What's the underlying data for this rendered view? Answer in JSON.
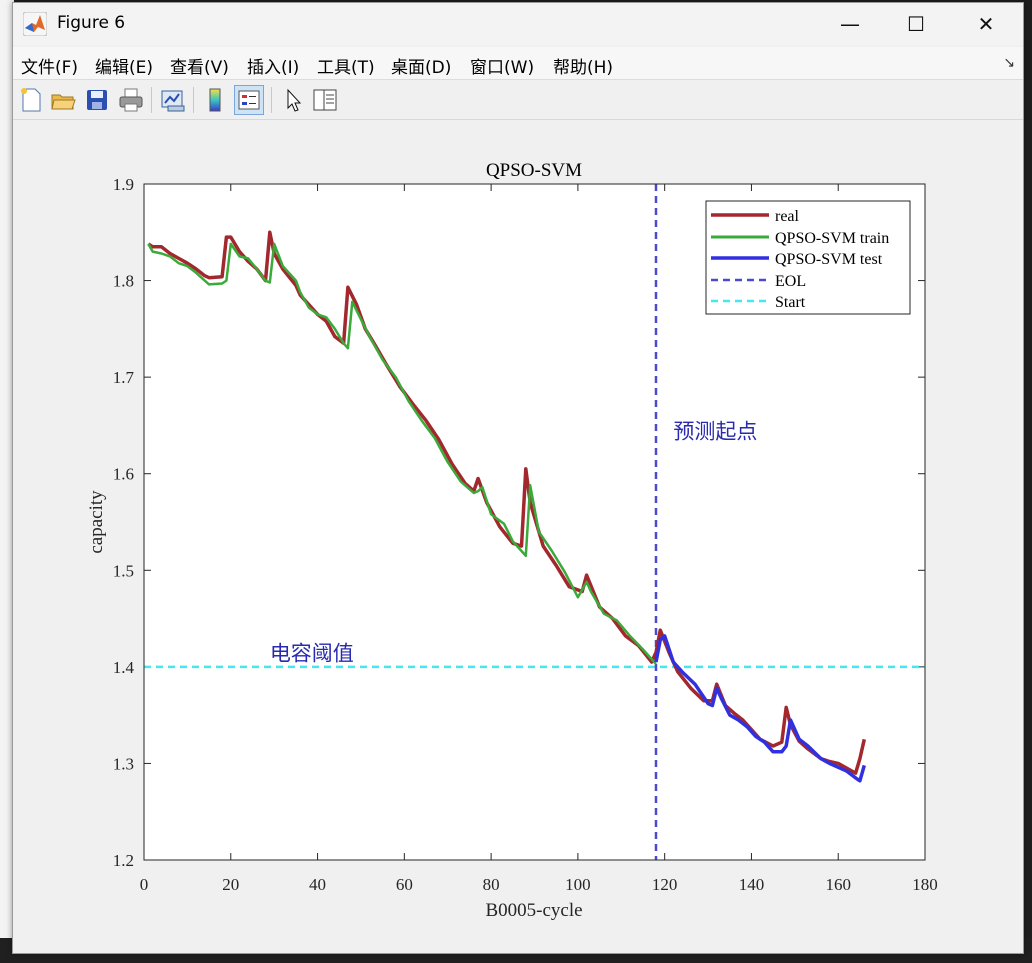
{
  "window": {
    "title": "Figure 6",
    "minimize_glyph": "—",
    "maximize_glyph": "☐",
    "close_glyph": "✕"
  },
  "menu": [
    "文件(F)",
    "编辑(E)",
    "查看(V)",
    "插入(I)",
    "工具(T)",
    "桌面(D)",
    "窗口(W)",
    "帮助(H)"
  ],
  "menu_arrow": "↘",
  "toolbar_icons": [
    "new-figure-icon",
    "open-file-icon",
    "save-icon",
    "print-icon",
    "link-plot-icon",
    "colorbar-icon",
    "legend-icon",
    "pointer-icon",
    "property-inspector-icon"
  ],
  "chart_data": {
    "type": "line",
    "title": "QPSO-SVM",
    "xlabel": "B0005-cycle",
    "ylabel": "capacity",
    "xlim": [
      0,
      180
    ],
    "ylim": [
      1.2,
      1.9
    ],
    "xticks": [
      0,
      20,
      40,
      60,
      80,
      100,
      120,
      140,
      160,
      180
    ],
    "yticks": [
      1.2,
      1.3,
      1.4,
      1.5,
      1.6,
      1.7,
      1.8,
      1.9
    ],
    "legend_position": "top-right",
    "legend": [
      "real",
      "QPSO-SVM train",
      "QPSO-SVM test",
      "EOL",
      "Start"
    ],
    "annotations": [
      {
        "text": "预测起点",
        "x": 122,
        "y": 1.645
      },
      {
        "text": "电容阈值",
        "x": 29,
        "y": 1.415
      }
    ],
    "colors": {
      "real": "#a2282e",
      "train": "#3aaa3a",
      "test": "#3030e0",
      "eol": "#4a4ad0",
      "start": "#44e8f0",
      "annotation": "#2a2ab0"
    },
    "eol_x": 118,
    "start_y": 1.4,
    "series": [
      {
        "name": "real",
        "x": [
          1,
          2,
          4,
          6,
          8,
          10,
          12,
          14,
          15,
          18,
          19,
          20,
          22,
          24,
          26,
          28,
          29,
          30,
          32,
          35,
          36,
          38,
          40,
          42,
          44,
          46,
          47,
          49,
          51,
          53,
          56,
          59,
          62,
          65,
          68,
          71,
          74,
          76,
          77,
          79,
          82,
          85,
          87,
          88,
          89,
          92,
          95,
          98,
          101,
          102,
          105,
          108,
          111,
          114,
          117,
          118,
          119,
          121,
          123,
          126,
          129,
          131,
          132,
          134,
          136,
          138,
          140,
          142,
          145,
          147,
          148,
          149,
          151,
          153,
          156,
          158,
          160,
          162,
          164,
          165,
          166
        ],
        "values": [
          1.838,
          1.835,
          1.835,
          1.828,
          1.823,
          1.818,
          1.812,
          1.805,
          1.803,
          1.804,
          1.845,
          1.845,
          1.83,
          1.82,
          1.812,
          1.8,
          1.85,
          1.828,
          1.812,
          1.795,
          1.785,
          1.775,
          1.765,
          1.758,
          1.742,
          1.735,
          1.793,
          1.775,
          1.75,
          1.735,
          1.712,
          1.69,
          1.672,
          1.655,
          1.635,
          1.61,
          1.59,
          1.582,
          1.595,
          1.57,
          1.545,
          1.528,
          1.525,
          1.605,
          1.57,
          1.525,
          1.505,
          1.483,
          1.478,
          1.495,
          1.462,
          1.45,
          1.432,
          1.422,
          1.405,
          1.415,
          1.438,
          1.415,
          1.395,
          1.378,
          1.365,
          1.365,
          1.382,
          1.36,
          1.352,
          1.345,
          1.335,
          1.325,
          1.318,
          1.322,
          1.358,
          1.34,
          1.323,
          1.315,
          1.305,
          1.302,
          1.3,
          1.295,
          1.29,
          1.305,
          1.325
        ]
      },
      {
        "name": "QPSO-SVM train",
        "x": [
          1,
          2,
          4,
          6,
          8,
          10,
          12,
          14,
          15,
          18,
          19,
          20,
          22,
          24,
          26,
          28,
          29,
          30,
          32,
          35,
          36,
          38,
          40,
          42,
          44,
          46,
          47,
          48,
          50,
          52,
          55,
          58,
          61,
          64,
          67,
          70,
          73,
          76,
          77,
          78,
          80,
          83,
          85,
          87,
          88,
          89,
          91,
          94,
          97,
          100,
          102,
          103,
          106,
          109,
          112,
          115,
          118
        ],
        "values": [
          1.838,
          1.83,
          1.828,
          1.825,
          1.818,
          1.815,
          1.808,
          1.8,
          1.796,
          1.797,
          1.8,
          1.838,
          1.825,
          1.823,
          1.812,
          1.8,
          1.798,
          1.838,
          1.815,
          1.8,
          1.788,
          1.772,
          1.765,
          1.762,
          1.75,
          1.735,
          1.73,
          1.778,
          1.76,
          1.742,
          1.718,
          1.7,
          1.675,
          1.655,
          1.637,
          1.612,
          1.592,
          1.58,
          1.582,
          1.586,
          1.558,
          1.548,
          1.53,
          1.52,
          1.515,
          1.588,
          1.54,
          1.52,
          1.498,
          1.472,
          1.488,
          1.478,
          1.455,
          1.448,
          1.432,
          1.418,
          1.403
        ]
      },
      {
        "name": "QPSO-SVM test",
        "x": [
          118,
          119,
          120,
          122,
          124,
          127,
          130,
          131,
          132,
          133,
          135,
          137,
          139,
          141,
          143,
          145,
          147,
          148,
          149,
          151,
          153,
          156,
          158,
          160,
          162,
          164,
          165,
          166
        ],
        "values": [
          1.405,
          1.428,
          1.432,
          1.405,
          1.395,
          1.382,
          1.362,
          1.36,
          1.378,
          1.368,
          1.35,
          1.345,
          1.338,
          1.328,
          1.322,
          1.312,
          1.312,
          1.318,
          1.345,
          1.325,
          1.318,
          1.305,
          1.3,
          1.296,
          1.292,
          1.285,
          1.282,
          1.298
        ]
      }
    ]
  }
}
